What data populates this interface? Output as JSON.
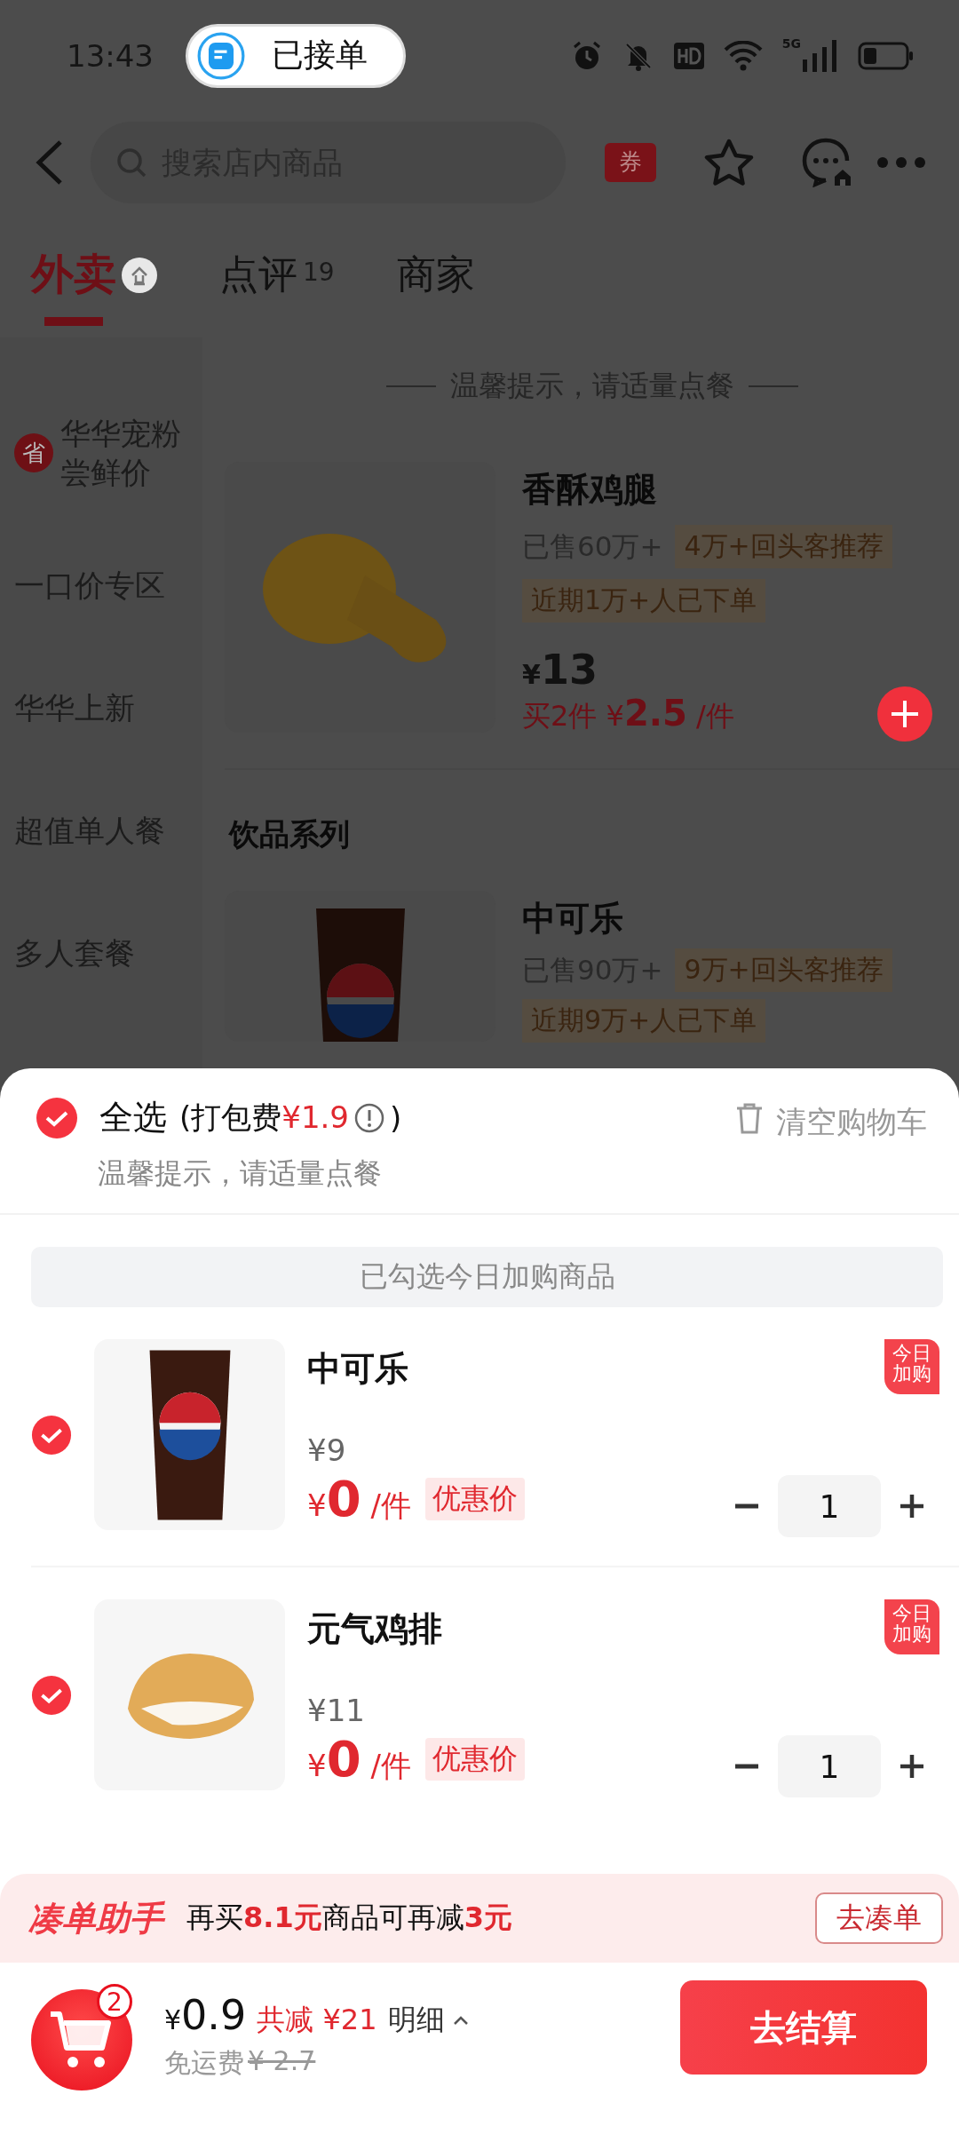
{
  "status_bar": {
    "time": "13:43",
    "notification": "已接单",
    "network": "5G"
  },
  "header": {
    "search_placeholder": "搜索店内商品",
    "coupon_label": "券"
  },
  "tabs": [
    {
      "label": "外卖",
      "selected": true
    },
    {
      "label": "点评",
      "count": "19",
      "selected": false
    },
    {
      "label": "商家",
      "selected": false
    }
  ],
  "sidebar": {
    "items": [
      {
        "label": "华华宠粉尝鲜价",
        "badge": "省"
      },
      {
        "label": "一口价专区"
      },
      {
        "label": "华华上新"
      },
      {
        "label": "超值单人餐"
      },
      {
        "label": "多人套餐"
      }
    ]
  },
  "menu": {
    "notice": "温馨提示，请适量点餐",
    "items": [
      {
        "kind": "product",
        "name": "香酥鸡腿",
        "sold": "已售60万+",
        "tags": [
          "4万+回头客推荐",
          "近期1万+人已下单"
        ],
        "currency": "¥",
        "price": "13",
        "deal_prefix": "买2件 ¥",
        "deal_price": "2.5",
        "deal_unit": "/件"
      },
      {
        "kind": "section",
        "title": "饮品系列"
      },
      {
        "kind": "product",
        "name": "中可乐",
        "sold": "已售90万+",
        "tags": [
          "9万+回头客推荐",
          "近期9万+人已下单"
        ]
      }
    ]
  },
  "cart": {
    "select_all": {
      "label": "全选",
      "checked": true,
      "fee_prefix": "(打包费",
      "fee": "¥1.9",
      "fee_suffix": ")"
    },
    "clear_label": "清空购物车",
    "notice": "温馨提示，请适量点餐",
    "group_title": "已勾选今日加购商品",
    "items": [
      {
        "name": "中可乐",
        "checked": true,
        "original_price": "¥9",
        "currency": "¥",
        "price": "0",
        "unit": "/件",
        "tag": "优惠价",
        "badge": "今日加购",
        "quantity": "1"
      },
      {
        "name": "元气鸡排",
        "checked": true,
        "original_price": "¥11",
        "currency": "¥",
        "price": "0",
        "unit": "/件",
        "tag": "优惠价",
        "badge": "今日加购",
        "quantity": "1"
      }
    ]
  },
  "helper": {
    "title": "凑单助手",
    "message": "再买**8.1元**商品可再减**3元**",
    "button": "去凑单"
  },
  "checkout": {
    "cart_count": "2",
    "currency": "¥",
    "total": "0.9",
    "discount": "共减 ¥21",
    "detail": "明细",
    "shipping": "免运费",
    "shipping_original": "¥ 2.7",
    "button": "去结算"
  }
}
